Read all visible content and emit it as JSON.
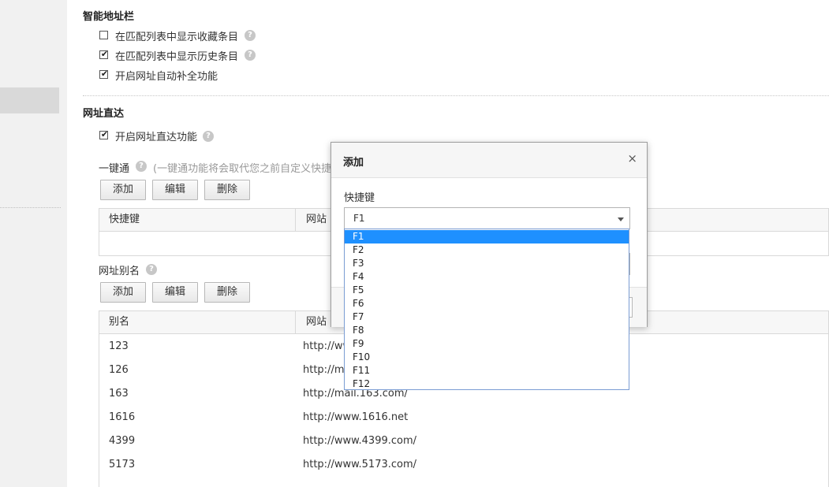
{
  "smart_bar": {
    "title": "智能地址栏",
    "options": [
      {
        "label": "在匹配列表中显示收藏条目",
        "checked": false,
        "help": "?"
      },
      {
        "label": "在匹配列表中显示历史条目",
        "checked": true,
        "help": "?"
      },
      {
        "label": "开启网址自动补全功能",
        "checked": true
      }
    ]
  },
  "direct": {
    "title": "网址直达",
    "enable_label": "开启网址直达功能",
    "enable_checked": true,
    "help": "?"
  },
  "one_key": {
    "label": "一键通",
    "help": "?",
    "note": "(一键通功能将会取代您之前自定义快捷",
    "buttons": {
      "add": "添加",
      "edit": "编辑",
      "delete": "删除"
    },
    "columns": {
      "key": "快捷键",
      "url": "网站"
    }
  },
  "alias": {
    "label": "网址别名",
    "help": "?",
    "buttons": {
      "add": "添加",
      "edit": "编辑",
      "delete": "删除"
    },
    "columns": {
      "alias": "别名",
      "url": "网站"
    },
    "rows": [
      {
        "alias": "123",
        "url": "http://ww"
      },
      {
        "alias": "126",
        "url": "http://ma"
      },
      {
        "alias": "163",
        "url": "http://mail.163.com/"
      },
      {
        "alias": "1616",
        "url": "http://www.1616.net"
      },
      {
        "alias": "4399",
        "url": "http://www.4399.com/"
      },
      {
        "alias": "5173",
        "url": "http://www.5173.com/"
      }
    ]
  },
  "dialog": {
    "title": "添加",
    "close": "×",
    "field_label": "快捷键",
    "selected": "F1"
  },
  "dropdown": {
    "options": [
      "F1",
      "F2",
      "F3",
      "F4",
      "F5",
      "F6",
      "F7",
      "F8",
      "F9",
      "F10",
      "F11",
      "F12"
    ],
    "active_index": 0
  },
  "colors": {
    "accent": "#1e90ff"
  },
  "checkmark": "✔"
}
